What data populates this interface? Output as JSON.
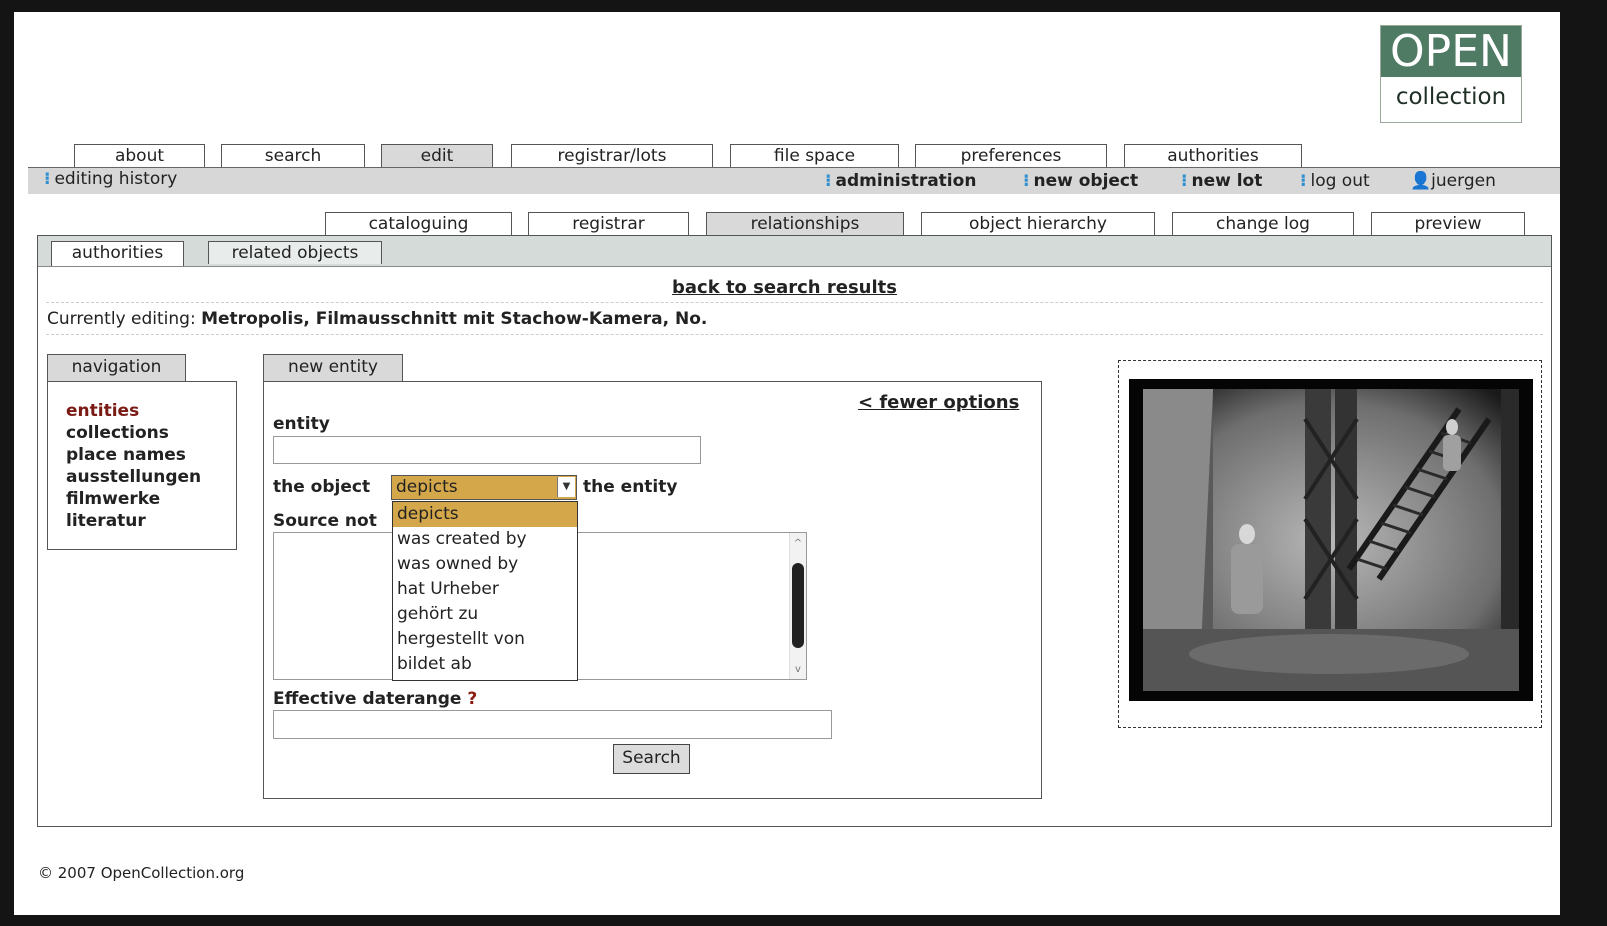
{
  "logo": {
    "line1": "OPEN",
    "line2": "collection"
  },
  "main_tabs": [
    {
      "label": "about"
    },
    {
      "label": "search"
    },
    {
      "label": "edit"
    },
    {
      "label": "registrar/lots"
    },
    {
      "label": "file space"
    },
    {
      "label": "preferences"
    },
    {
      "label": "authorities"
    }
  ],
  "subnav": {
    "editing_history": "editing history",
    "administration": "administration",
    "new_object": "new object",
    "new_lot": "new lot",
    "log_out": "log out",
    "user": "juergen"
  },
  "edit_tabs": [
    {
      "label": "cataloguing"
    },
    {
      "label": "registrar"
    },
    {
      "label": "relationships"
    },
    {
      "label": "object hierarchy"
    },
    {
      "label": "change log"
    },
    {
      "label": "preview"
    }
  ],
  "rel_tabs": [
    {
      "label": "authorities"
    },
    {
      "label": "related objects"
    }
  ],
  "back_link": "back to search results",
  "editing": {
    "prefix": "Currently editing:",
    "title": "Metropolis, Filmausschnitt mit Stachow-Kamera, No."
  },
  "navigation": {
    "tab": "navigation",
    "items": [
      "entities",
      "collections",
      "place names",
      "ausstellungen",
      "filmwerke",
      "literatur"
    ]
  },
  "form": {
    "tab": "new entity",
    "fewer_options": "< fewer options",
    "entity_label": "entity",
    "entity_value": "",
    "object_label": "the object",
    "relation_selected": "depicts",
    "entity_suffix": "the entity",
    "relation_options": [
      "depicts",
      "was created by",
      "was owned by",
      "hat Urheber",
      "gehört zu",
      "hergestellt von",
      "bildet ab"
    ],
    "source_label": "Source not",
    "daterange_label": "Effective daterange",
    "daterange_help": "?",
    "search_button": "Search"
  },
  "footer": "© 2007 OpenCollection.org"
}
